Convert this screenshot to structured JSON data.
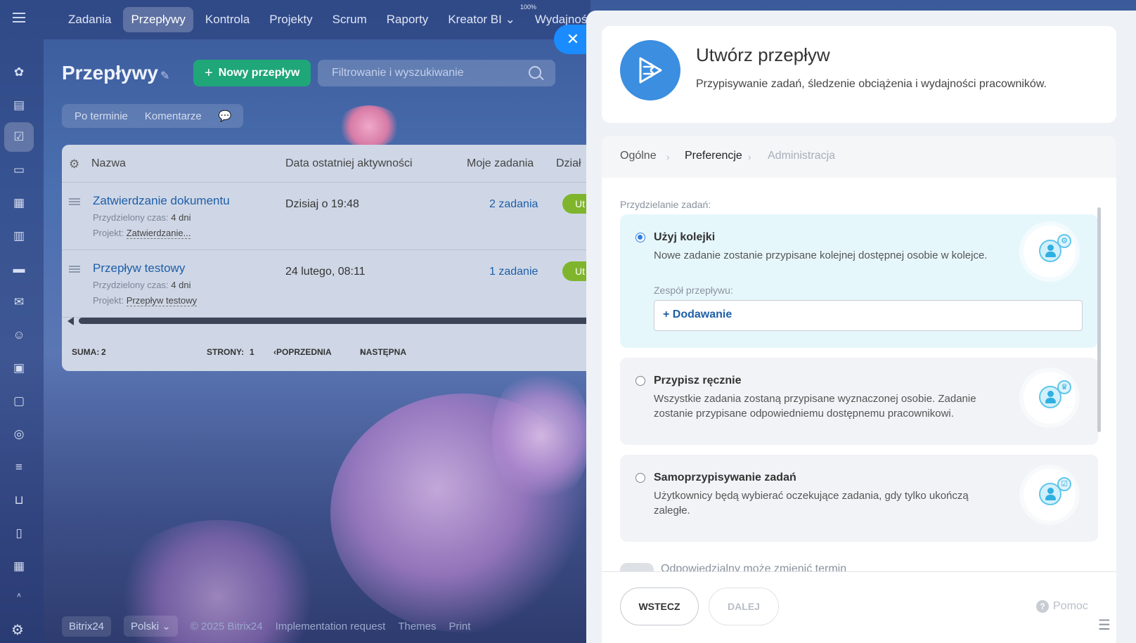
{
  "topnav": {
    "items": [
      "Zadania",
      "Przepływy",
      "Kontrola",
      "Projekty",
      "Scrum",
      "Raporty",
      "Kreator BI ⌄",
      "Wydajność"
    ],
    "sup_label": "100%"
  },
  "page": {
    "title": "Przepływy",
    "new_button": "Nowy przepływ",
    "search_placeholder": "Filtrowanie i wyszukiwanie",
    "filter_pills": [
      "Po terminie",
      "Komentarze"
    ]
  },
  "table": {
    "columns": [
      "Nazwa",
      "Data ostatniej aktywności",
      "Moje zadania",
      "Dział"
    ],
    "rows": [
      {
        "name": "Zatwierdzanie dokumentu",
        "time_label": "Przydzielony czas:",
        "time_value": "4 dni",
        "project_label": "Projekt:",
        "project_value": "Zatwierdzanie...",
        "date": "Dzisiaj o 19:48",
        "tasks": "2 zadania",
        "badge": "Ut"
      },
      {
        "name": "Przepływ testowy",
        "time_label": "Przydzielony czas:",
        "time_value": "4 dni",
        "project_label": "Projekt:",
        "project_value": "Przepływ testowy",
        "date": "24 lutego, 08:11",
        "tasks": "1 zadanie",
        "badge": "Ut"
      }
    ],
    "footer": {
      "sum_label": "SUMA:",
      "sum_value": "2",
      "pages_label": "STRONY:",
      "pages_value": "1",
      "prev": "POPRZEDNIA",
      "next": "NASTĘPNA"
    }
  },
  "footer": {
    "brand": "Bitrix24",
    "language": "Polski ⌄",
    "copyright": "© 2025 Bitrix24",
    "links": [
      "Implementation request",
      "Themes",
      "Print"
    ]
  },
  "panel": {
    "title": "Utwórz przepływ",
    "subtitle": "Przypisywanie zadań, śledzenie obciążenia i wydajności pracowników.",
    "steps": [
      "Ogólne",
      "Preferencje",
      "Administracja"
    ],
    "section_label": "Przydzielanie zadań:",
    "options": [
      {
        "title": "Użyj kolejki",
        "desc": "Nowe zadanie zostanie przypisane kolejnej dostępnej osobie w kolejce.",
        "selected": true
      },
      {
        "title": "Przypisz ręcznie",
        "desc": "Wszystkie zadania zostaną przypisane wyznaczonej osobie. Zadanie zostanie przypisane odpowiedniemu dostępnemu pracownikowi.",
        "selected": false
      },
      {
        "title": "Samoprzypisywanie zadań",
        "desc": "Użytkownicy będą wybierać oczekujące zadania, gdy tylko ukończą zaległe.",
        "selected": false
      }
    ],
    "team_label": "Zespół przepływu:",
    "team_add": "+ Dodawanie",
    "toggle_label": "Odpowiedzialny może zmienić termin",
    "back_button": "WSTECZ",
    "next_button": "DALEJ",
    "help": "Pomoc"
  },
  "colors": {
    "accent": "#1a8cff",
    "new_button": "#1fa77a",
    "link": "#1e5ea8",
    "badge": "#7fb52c"
  }
}
